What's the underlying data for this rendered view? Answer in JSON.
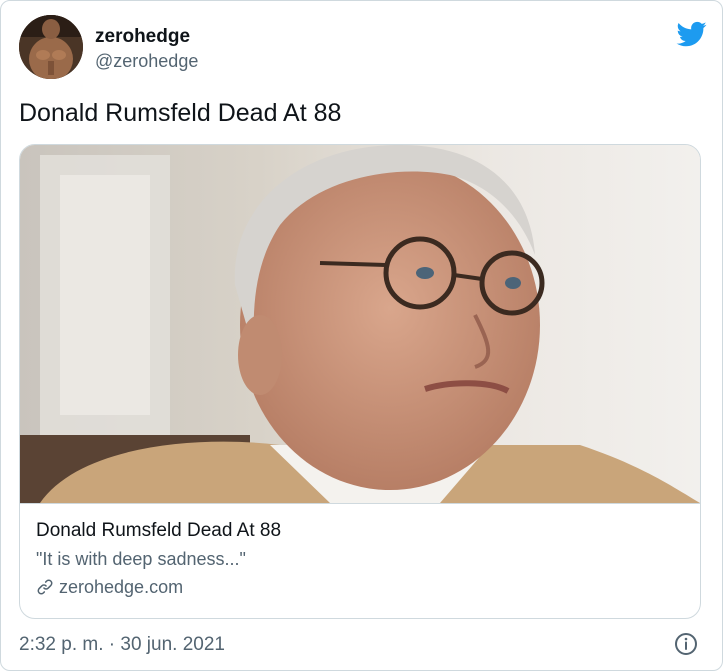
{
  "author": {
    "display_name": "zerohedge",
    "handle": "@zerohedge",
    "avatar_icon": "avatar-portrait"
  },
  "tweet": {
    "text": "Donald Rumsfeld Dead At 88",
    "timestamp": "2:32 p. m. · 30 jun. 2021"
  },
  "card": {
    "title": "Donald Rumsfeld Dead At 88",
    "description": "\"It is with deep sadness...\"",
    "domain": "zerohedge.com"
  },
  "icons": {
    "brand": "twitter-bird-icon",
    "link": "link-icon",
    "info": "info-icon"
  },
  "colors": {
    "twitter_blue": "#1d9bf0",
    "text_primary": "#0f1419",
    "text_secondary": "#536471",
    "border": "#cfd9de"
  }
}
